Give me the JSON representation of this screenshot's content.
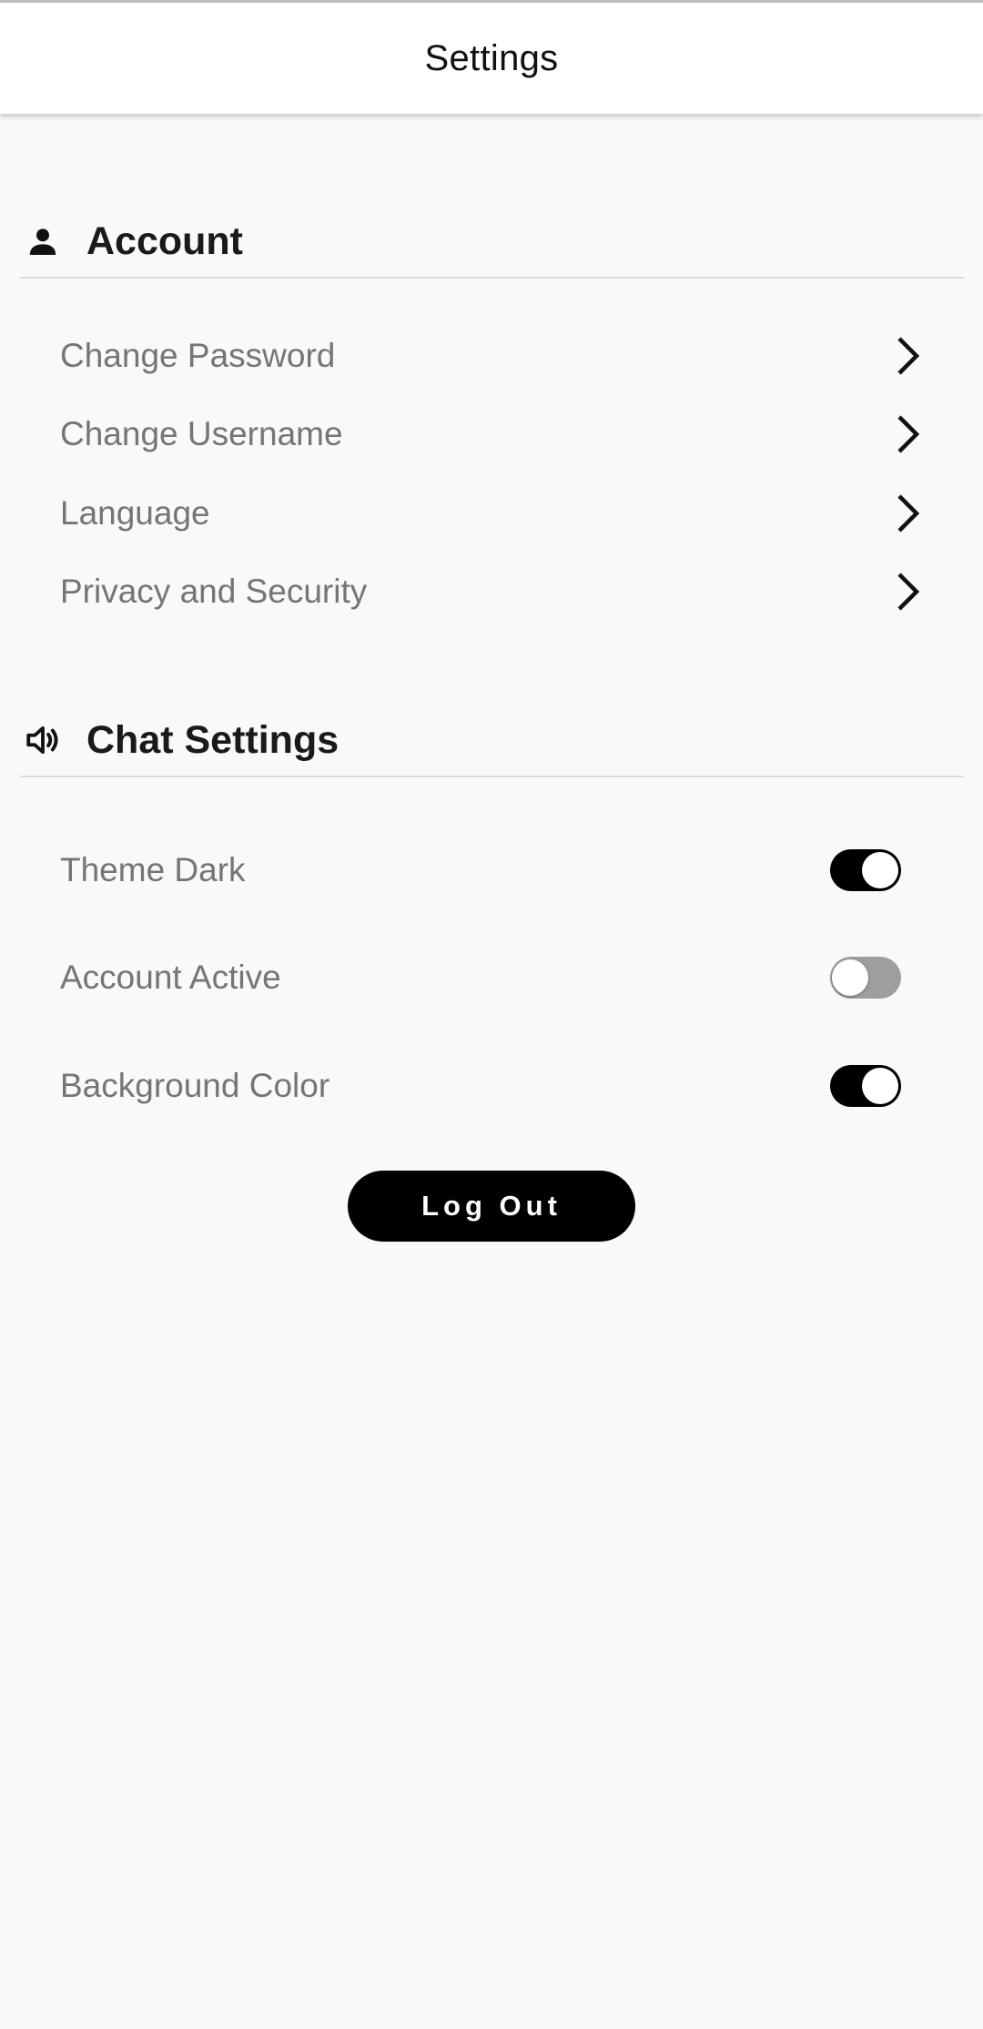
{
  "app_bar": {
    "title": "Settings"
  },
  "sections": {
    "account": {
      "title": "Account",
      "icon": "person-icon",
      "items": [
        {
          "label": "Change Password",
          "icon": "chevron-right-icon"
        },
        {
          "label": "Change Username",
          "icon": "chevron-right-icon"
        },
        {
          "label": "Language",
          "icon": "chevron-right-icon"
        },
        {
          "label": "Privacy and Security",
          "icon": "chevron-right-icon"
        }
      ]
    },
    "chat": {
      "title": "Chat Settings",
      "icon": "volume-icon",
      "toggles": [
        {
          "label": "Theme Dark",
          "on": true
        },
        {
          "label": "Account Active",
          "on": false
        },
        {
          "label": "Background Color",
          "on": true
        }
      ]
    }
  },
  "logout": {
    "label": "Log Out"
  },
  "colors": {
    "background": "#f9f9f9",
    "accent": "#000000",
    "row_text": "#757575",
    "switch_off": "#9e9e9e"
  }
}
